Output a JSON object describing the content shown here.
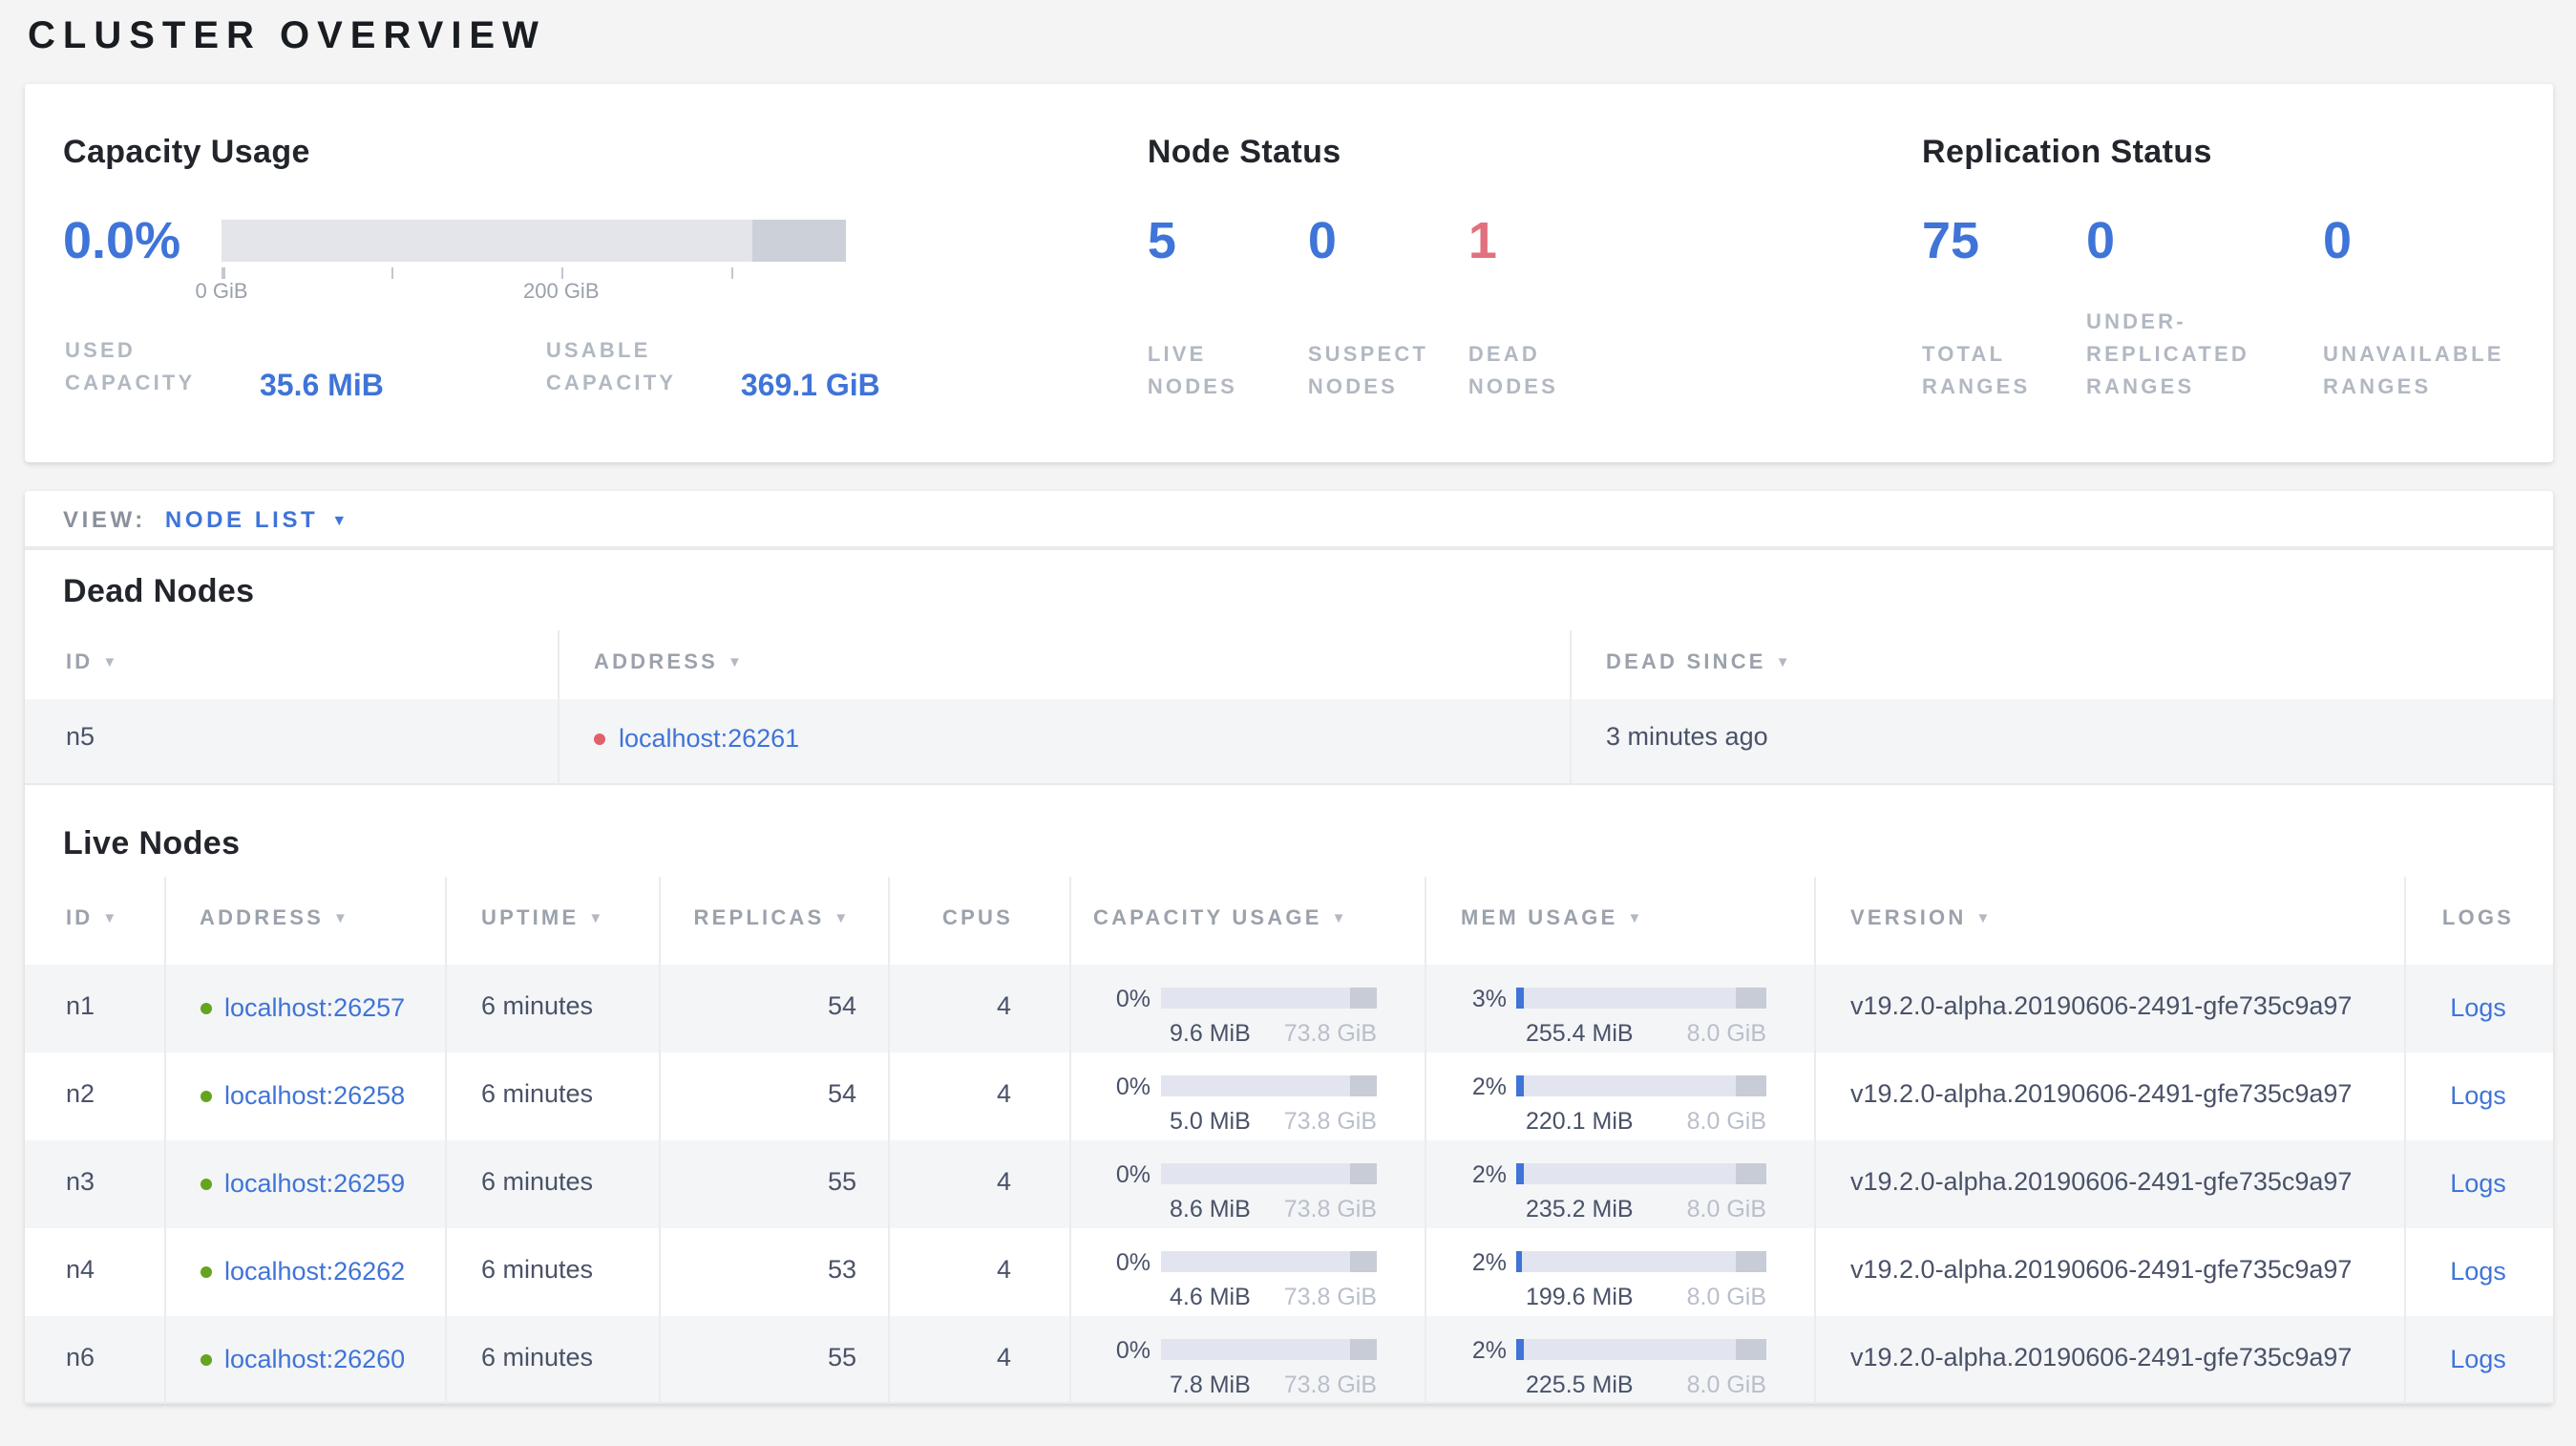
{
  "page_title": "CLUSTER OVERVIEW",
  "colors": {
    "accent_blue": "#3f74d8",
    "alert_red": "#e2707e",
    "live_green": "#65a41e",
    "dead_dot_red": "#e0606c",
    "label_gray": "#b2b8c2",
    "row_stripe": "#f4f5f7"
  },
  "icons": {
    "sort_desc": "▼",
    "dropdown_arrow": "▼"
  },
  "summary": {
    "capacity_usage": {
      "title": "Capacity Usage",
      "percent": "0.0%",
      "bar": {
        "fill_pct": 0,
        "reserved_pct": 15
      },
      "tick_labels": {
        "start": "0 GiB",
        "mid": "200 GiB"
      },
      "stats": [
        {
          "label": "USED CAPACITY",
          "value": "35.6 MiB"
        },
        {
          "label": "USABLE CAPACITY",
          "value": "369.1 GiB"
        }
      ]
    },
    "node_status": {
      "title": "Node Status",
      "stats": [
        {
          "value": "5",
          "label": "LIVE NODES",
          "tone": "blue"
        },
        {
          "value": "0",
          "label": "SUSPECT NODES",
          "tone": "blue"
        },
        {
          "value": "1",
          "label": "DEAD NODES",
          "tone": "red"
        }
      ]
    },
    "replication_status": {
      "title": "Replication Status",
      "stats": [
        {
          "value": "75",
          "label": "TOTAL RANGES",
          "tone": "blue"
        },
        {
          "value": "0",
          "label": "UNDER-REPLICATED RANGES",
          "tone": "blue"
        },
        {
          "value": "0",
          "label": "UNAVAILABLE RANGES",
          "tone": "blue"
        }
      ]
    }
  },
  "view_bar": {
    "label": "VIEW:",
    "selected": "NODE LIST"
  },
  "dead_nodes": {
    "title": "Dead Nodes",
    "columns": [
      {
        "label": "ID",
        "sorted": true
      },
      {
        "label": "ADDRESS",
        "sorted": true
      },
      {
        "label": "DEAD SINCE",
        "sorted": true
      }
    ],
    "rows": [
      {
        "id": "n5",
        "address": "localhost:26261",
        "dead_since": "3 minutes ago"
      }
    ]
  },
  "live_nodes": {
    "title": "Live Nodes",
    "columns": [
      {
        "label": "ID",
        "sorted": true
      },
      {
        "label": "ADDRESS",
        "sorted": true
      },
      {
        "label": "UPTIME",
        "sorted": true
      },
      {
        "label": "REPLICAS",
        "sorted": true
      },
      {
        "label": "CPUS",
        "sorted": false
      },
      {
        "label": "CAPACITY USAGE",
        "sorted": true
      },
      {
        "label": "MEM USAGE",
        "sorted": true
      },
      {
        "label": "VERSION",
        "sorted": true
      },
      {
        "label": "LOGS",
        "sorted": false
      }
    ],
    "logs_label": "Logs",
    "rows": [
      {
        "id": "n1",
        "address": "localhost:26257",
        "uptime": "6 minutes",
        "replicas": "54",
        "cpus": "4",
        "capacity": {
          "percent": "0%",
          "fill_pct": 0,
          "used": "9.6 MiB",
          "total": "73.8 GiB"
        },
        "memory": {
          "percent": "3%",
          "fill_pct": 3,
          "used": "255.4 MiB",
          "total": "8.0 GiB"
        },
        "version": "v19.2.0-alpha.20190606-2491-gfe735c9a97"
      },
      {
        "id": "n2",
        "address": "localhost:26258",
        "uptime": "6 minutes",
        "replicas": "54",
        "cpus": "4",
        "capacity": {
          "percent": "0%",
          "fill_pct": 0,
          "used": "5.0 MiB",
          "total": "73.8 GiB"
        },
        "memory": {
          "percent": "2%",
          "fill_pct": 2.7,
          "used": "220.1 MiB",
          "total": "8.0 GiB"
        },
        "version": "v19.2.0-alpha.20190606-2491-gfe735c9a97"
      },
      {
        "id": "n3",
        "address": "localhost:26259",
        "uptime": "6 minutes",
        "replicas": "55",
        "cpus": "4",
        "capacity": {
          "percent": "0%",
          "fill_pct": 0,
          "used": "8.6 MiB",
          "total": "73.8 GiB"
        },
        "memory": {
          "percent": "2%",
          "fill_pct": 2.9,
          "used": "235.2 MiB",
          "total": "8.0 GiB"
        },
        "version": "v19.2.0-alpha.20190606-2491-gfe735c9a97"
      },
      {
        "id": "n4",
        "address": "localhost:26262",
        "uptime": "6 minutes",
        "replicas": "53",
        "cpus": "4",
        "capacity": {
          "percent": "0%",
          "fill_pct": 0,
          "used": "4.6 MiB",
          "total": "73.8 GiB"
        },
        "memory": {
          "percent": "2%",
          "fill_pct": 2.4,
          "used": "199.6 MiB",
          "total": "8.0 GiB"
        },
        "version": "v19.2.0-alpha.20190606-2491-gfe735c9a97"
      },
      {
        "id": "n6",
        "address": "localhost:26260",
        "uptime": "6 minutes",
        "replicas": "55",
        "cpus": "4",
        "capacity": {
          "percent": "0%",
          "fill_pct": 0,
          "used": "7.8 MiB",
          "total": "73.8 GiB"
        },
        "memory": {
          "percent": "2%",
          "fill_pct": 2.8,
          "used": "225.5 MiB",
          "total": "8.0 GiB"
        },
        "version": "v19.2.0-alpha.20190606-2491-gfe735c9a97"
      }
    ]
  }
}
